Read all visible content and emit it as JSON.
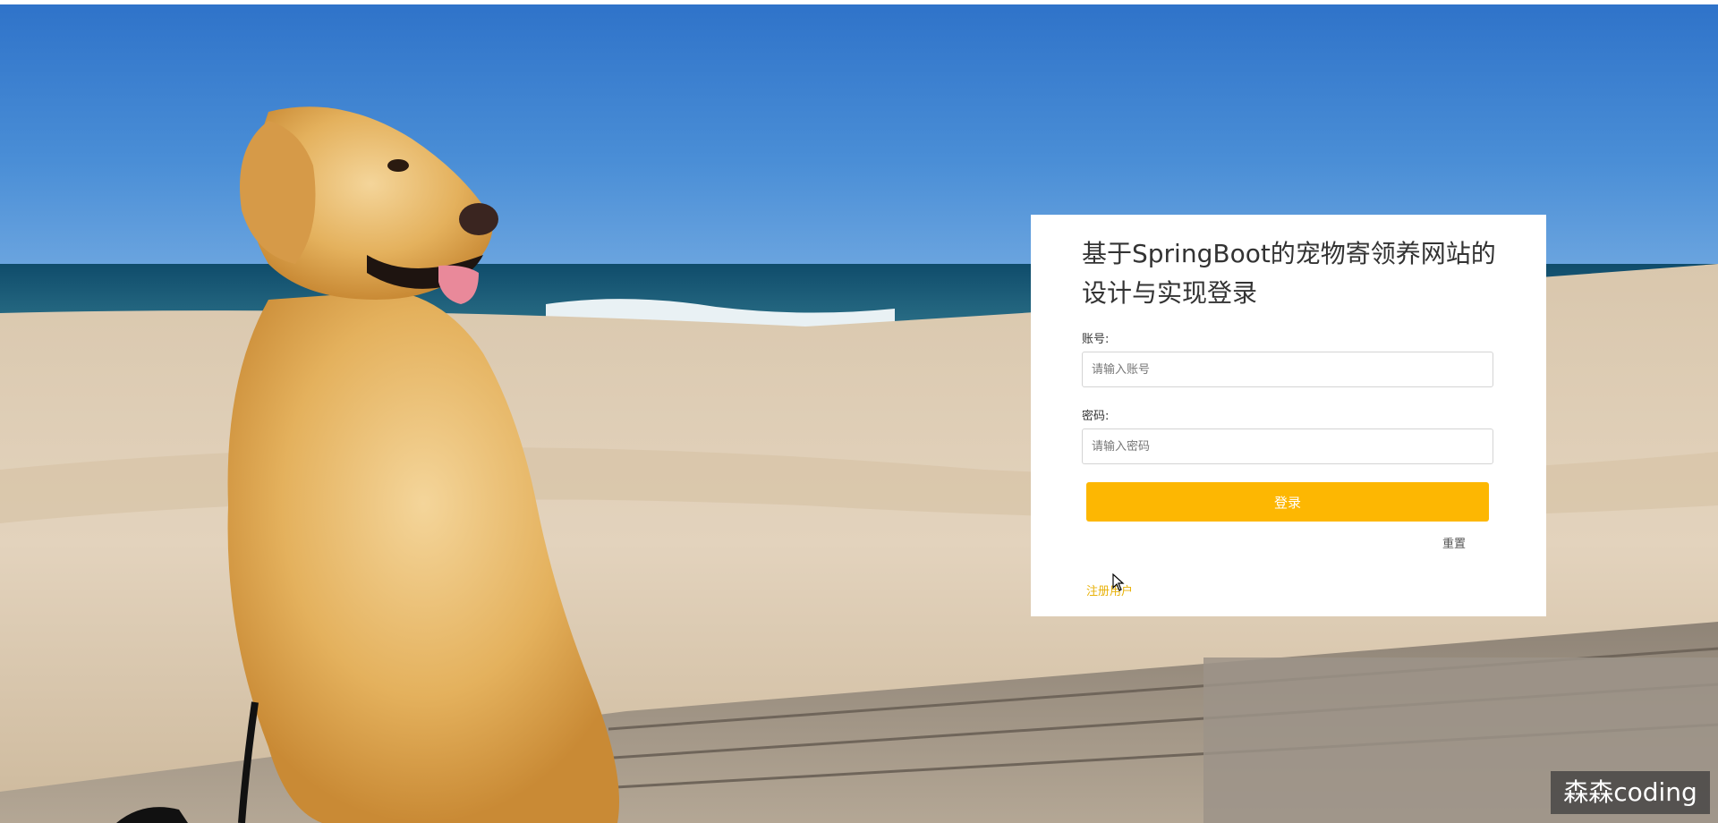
{
  "login": {
    "title": "基于SpringBoot的宠物寄领养网站的设计与实现登录",
    "account_label": "账号:",
    "account_placeholder": "请输入账号",
    "account_value": "",
    "password_label": "密码:",
    "password_placeholder": "请输入密码",
    "password_value": "",
    "login_button": "登录",
    "reset_link": "重置",
    "register_link": "注册用户"
  },
  "background": {
    "icon": "beach-golden-retriever-photo"
  },
  "colors": {
    "accent": "#fdb702",
    "register_link": "#e8b20a"
  },
  "watermark": {
    "text": "森森coding"
  }
}
